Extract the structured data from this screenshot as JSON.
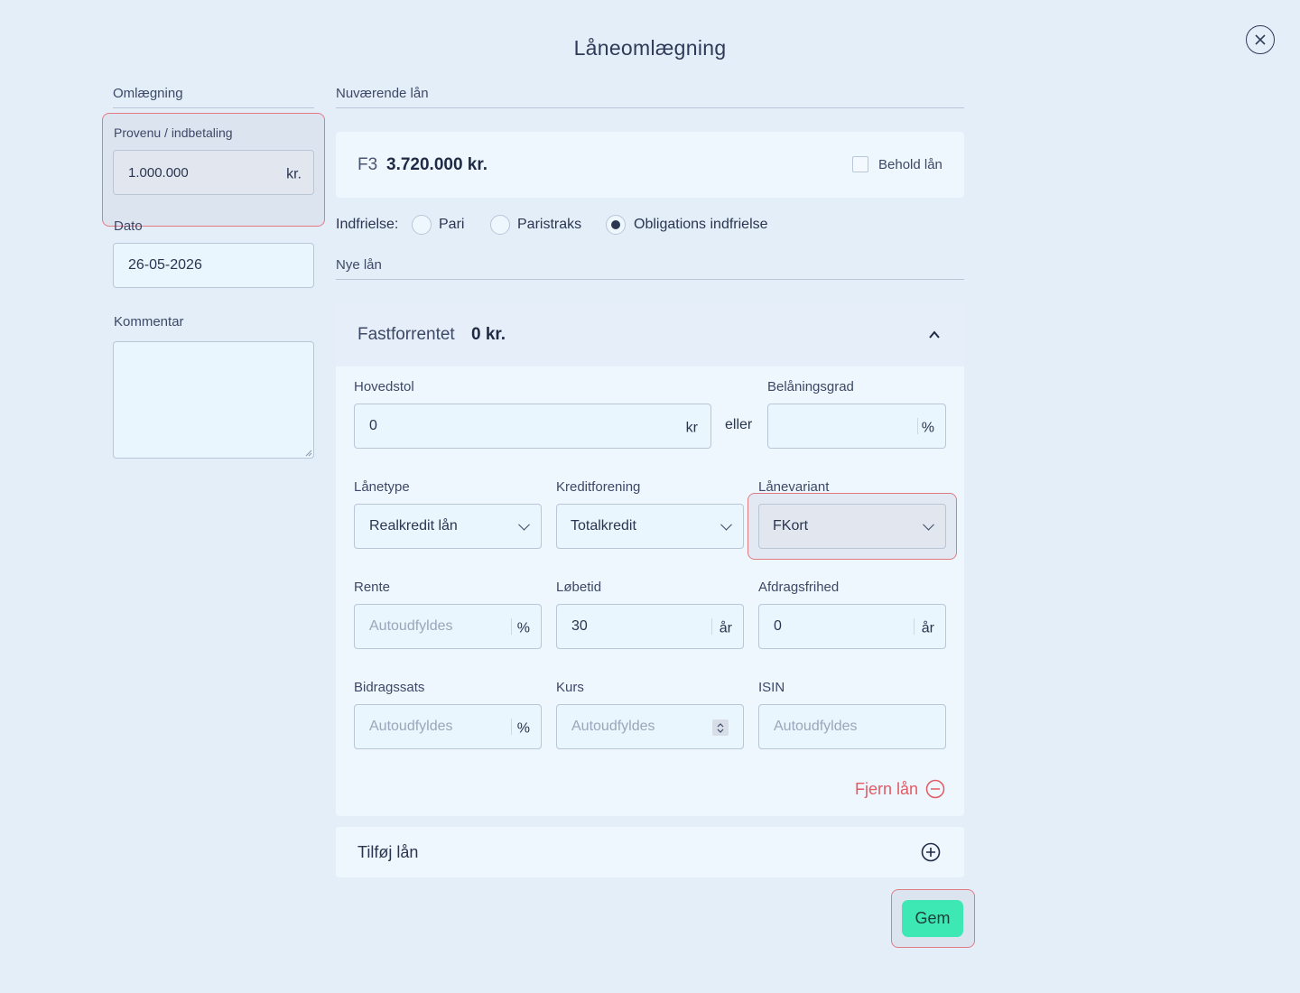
{
  "title": "Låneomlægning",
  "left": {
    "section_label": "Omlægning",
    "proceeds": {
      "label": "Provenu / indbetaling",
      "value": "1.000.000",
      "unit": "kr."
    },
    "date": {
      "label": "Dato",
      "value": "26-05-2026"
    },
    "comment": {
      "label": "Kommentar",
      "value": ""
    }
  },
  "current_loans": {
    "section_label": "Nuværende lån",
    "loan": {
      "name": "F3",
      "amount": "3.720.000 kr.",
      "keep_label": "Behold lån",
      "keep_checked": false
    },
    "redemption": {
      "label": "Indfrielse:",
      "options": [
        "Pari",
        "Paristraks",
        "Obligations indfrielse"
      ],
      "selected": "Obligations indfrielse"
    }
  },
  "new_loans": {
    "section_label": "Nye lån",
    "loan": {
      "type_title": "Fastforrentet",
      "amount": "0 kr.",
      "principal": {
        "label": "Hovedstol",
        "value": "0",
        "unit": "kr"
      },
      "or_label": "eller",
      "ltv": {
        "label": "Belåningsgrad",
        "value": "",
        "unit": "%"
      },
      "loan_type": {
        "label": "Lånetype",
        "value": "Realkredit lån"
      },
      "credit_union": {
        "label": "Kreditforening",
        "value": "Totalkredit"
      },
      "variant": {
        "label": "Lånevariant",
        "value": "FKort"
      },
      "rate": {
        "label": "Rente",
        "placeholder": "Autoudfyldes",
        "unit": "%"
      },
      "term": {
        "label": "Løbetid",
        "value": "30",
        "unit": "år"
      },
      "interest_only": {
        "label": "Afdragsfrihed",
        "value": "0",
        "unit": "år"
      },
      "contribution": {
        "label": "Bidragssats",
        "placeholder": "Autoudfyldes",
        "unit": "%"
      },
      "price": {
        "label": "Kurs",
        "placeholder": "Autoudfyldes"
      },
      "isin": {
        "label": "ISIN",
        "placeholder": "Autoudfyldes"
      },
      "remove_label": "Fjern lån"
    },
    "add_label": "Tilføj lån"
  },
  "save_label": "Gem",
  "colors": {
    "background": "#e4eef9",
    "accent_save": "#3ee8b5",
    "danger": "#e25a63",
    "highlight_border": "#e07a85"
  }
}
